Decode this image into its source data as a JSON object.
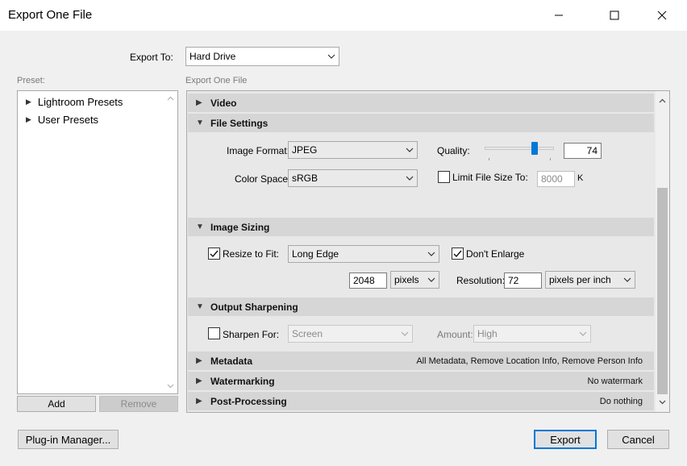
{
  "window": {
    "title": "Export One File",
    "minimize_icon": "minimize-icon",
    "maximize_icon": "maximize-icon",
    "close_icon": "close-icon"
  },
  "export_to": {
    "label": "Export To:",
    "value": "Hard Drive"
  },
  "preset_panel": {
    "label": "Preset:",
    "items": [
      {
        "label": "Lightroom Presets"
      },
      {
        "label": "User Presets"
      }
    ],
    "add_label": "Add",
    "remove_label": "Remove"
  },
  "content_label": "Export One File",
  "sections": {
    "video": {
      "title": "Video"
    },
    "file_settings": {
      "title": "File Settings",
      "image_format_label": "Image Format:",
      "image_format_value": "JPEG",
      "quality_label": "Quality:",
      "quality_value": "74",
      "quality_level": 0.74,
      "color_space_label": "Color Space:",
      "color_space_value": "sRGB",
      "limit_size_label": "Limit File Size To:",
      "limit_size_value": "8000",
      "limit_size_unit": "K"
    },
    "image_sizing": {
      "title": "Image Sizing",
      "resize_label": "Resize to Fit:",
      "resize_value": "Long Edge",
      "dont_enlarge_label": "Don't Enlarge",
      "size_value": "2048",
      "size_unit": "pixels",
      "resolution_label": "Resolution:",
      "resolution_value": "72",
      "resolution_unit": "pixels per inch"
    },
    "output_sharpening": {
      "title": "Output Sharpening",
      "sharpen_label": "Sharpen For:",
      "sharpen_value": "Screen",
      "amount_label": "Amount:",
      "amount_value": "High"
    },
    "metadata": {
      "title": "Metadata",
      "summary": "All Metadata, Remove Location Info, Remove Person Info"
    },
    "watermarking": {
      "title": "Watermarking",
      "summary": "No watermark"
    },
    "post_processing": {
      "title": "Post-Processing",
      "summary": "Do nothing"
    }
  },
  "footer": {
    "plugin_manager_label": "Plug-in Manager...",
    "export_label": "Export",
    "cancel_label": "Cancel"
  },
  "colors": {
    "accent": "#0078d7",
    "section_header": "#d6d6d6",
    "section_body": "#e8e8e8",
    "scrollbar_thumb": "#bdbdbd"
  }
}
